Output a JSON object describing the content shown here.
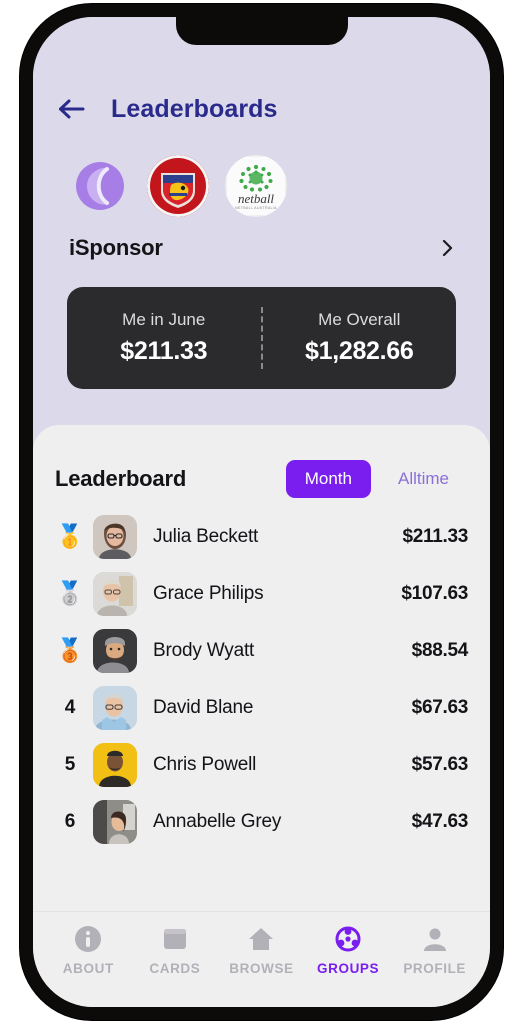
{
  "header": {
    "back_icon": "arrow-left-icon",
    "title": "Leaderboards",
    "title_color": "#2a2a8c"
  },
  "logos": [
    {
      "name": "isponsor-logo",
      "alt": "iSponsor S monogram",
      "type": "monogram"
    },
    {
      "name": "team-crest-logo",
      "alt": "Red team crest with lion",
      "type": "crest"
    },
    {
      "name": "netball-logo",
      "alt": "netball",
      "label": "netball",
      "sublabel": "NETBALL AUSTRALIA",
      "type": "netball"
    }
  ],
  "sponsor_selector": {
    "name": "iSponsor",
    "chevron_icon": "chevron-right-icon"
  },
  "stats": [
    {
      "label": "Me in June",
      "value": "$211.33"
    },
    {
      "label": "Me Overall",
      "value": "$1,282.66"
    }
  ],
  "leaderboard": {
    "title": "Leaderboard",
    "filters": [
      {
        "label": "Month",
        "active": true
      },
      {
        "label": "Alltime",
        "active": false
      }
    ],
    "active_color": "#7a1ef0",
    "inactive_color": "#8b6fd8",
    "rows": [
      {
        "rank": "1",
        "medal": "🥇",
        "name": "Julia Beckett",
        "amount": "$211.33",
        "avatar_bg": "#cfc7bf",
        "avatar_tone": "#6b4f3f"
      },
      {
        "rank": "2",
        "medal": "🥈",
        "name": "Grace Philips",
        "amount": "$107.63",
        "avatar_bg": "#d8d8d6",
        "avatar_tone": "#b9b4ad"
      },
      {
        "rank": "3",
        "medal": "🥉",
        "name": "Brody Wyatt",
        "amount": "$88.54",
        "avatar_bg": "#3a3a3c",
        "avatar_tone": "#8d8d92"
      },
      {
        "rank": "4",
        "medal": "",
        "name": "David Blane",
        "amount": "$67.63",
        "avatar_bg": "#c7d8e4",
        "avatar_tone": "#8fb7d4"
      },
      {
        "rank": "5",
        "medal": "",
        "name": "Chris Powell",
        "amount": "$57.63",
        "avatar_bg": "#f2c014",
        "avatar_tone": "#2e2a26"
      },
      {
        "rank": "6",
        "medal": "",
        "name": "Annabelle Grey",
        "amount": "$47.63",
        "avatar_bg": "#6f6f6d",
        "avatar_tone": "#c8c4bd"
      }
    ]
  },
  "tab_bar": {
    "items": [
      {
        "label": "ABOUT",
        "icon": "info-icon",
        "active": false
      },
      {
        "label": "CARDS",
        "icon": "wallet-icon",
        "active": false
      },
      {
        "label": "BROWSE",
        "icon": "home-icon",
        "active": false
      },
      {
        "label": "GROUPS",
        "icon": "groups-icon",
        "active": true
      },
      {
        "label": "PROFILE",
        "icon": "person-icon",
        "active": false
      }
    ]
  }
}
